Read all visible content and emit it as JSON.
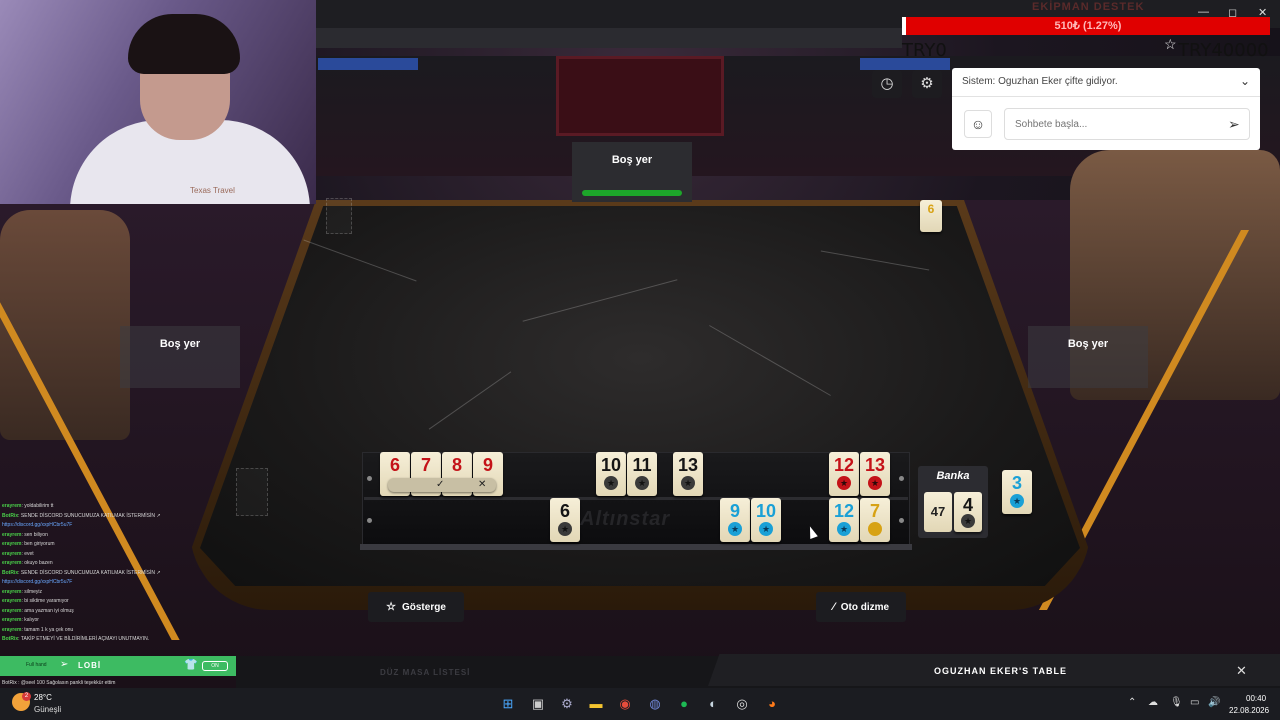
{
  "stream": {
    "donation_title": "EKİPMAN DESTEK",
    "donation_progress_text": "510₺ (1.27%)",
    "donation_progress": 0.0127,
    "goal_current": "TRY0",
    "goal_target": "TRY40000"
  },
  "game": {
    "seats": {
      "top": "Boş yer",
      "left": "Boş yer",
      "right": "Boş yer"
    },
    "discard_tile": {
      "value": "6",
      "color": "yellow"
    },
    "rack": {
      "brand": "Altınstar",
      "row1": [
        {
          "value": "6",
          "color": "red"
        },
        {
          "value": "7",
          "color": "red"
        },
        {
          "value": "8",
          "color": "red"
        },
        {
          "value": "9",
          "color": "red"
        },
        {
          "value": "10",
          "color": "black"
        },
        {
          "value": "11",
          "color": "black"
        },
        {
          "value": "13",
          "color": "black"
        },
        {
          "value": "12",
          "color": "red"
        },
        {
          "value": "13",
          "color": "red"
        }
      ],
      "row2": [
        {
          "value": "6",
          "color": "black"
        },
        {
          "value": "9",
          "color": "blue"
        },
        {
          "value": "10",
          "color": "blue"
        },
        {
          "value": "12",
          "color": "blue"
        },
        {
          "value": "7",
          "color": "yellow"
        }
      ]
    },
    "bank": {
      "title": "Banka",
      "count": "47",
      "indicator": {
        "value": "4",
        "color": "black"
      }
    },
    "extra_tile": {
      "value": "3",
      "color": "blue"
    },
    "buttons": {
      "gosterge": "Gösterge",
      "oto_dizme": "Oto dizme"
    },
    "colors": {
      "red": "#c41218",
      "black": "#151515",
      "blue": "#1aa0d6",
      "yellow": "#d7a215",
      "ready_bar": "#1da62a"
    }
  },
  "chat": {
    "system_message": "Sistem: Oguzhan Eker çifte gidiyor.",
    "input_placeholder": "Sohbete başla..."
  },
  "lobby": {
    "label": "LOBİ",
    "masa_list": "DÜZ MASA LİSTESİ",
    "table_title": "OGUZHAN EKER'S TABLE"
  },
  "twitch_chat": [
    {
      "user": "erayrem",
      "text": ": yoldabilirim tt"
    },
    {
      "user": "BotRix",
      "text": ": SENDE DİSCORD SUNUCUMUZA KATILMAK İSTERMİSİN ↗"
    },
    {
      "user": "",
      "text": "https://discord.gg/xxpHCbr5u7F",
      "link": true
    },
    {
      "user": "erayrem",
      "text": ": sen biliyon"
    },
    {
      "user": "erayrem",
      "text": ": ben giriyorum"
    },
    {
      "user": "erayrem",
      "text": ": evet"
    },
    {
      "user": "erayrem",
      "text": ": okuyo bazen"
    },
    {
      "user": "BotRix",
      "text": ": SENDE DİSCORD SUNUCUMUZA KATILMAK İSTERMİSİN ↗"
    },
    {
      "user": "",
      "text": "https://discord.gg/xxpHCbr5u7F",
      "link": true
    },
    {
      "user": "erayrem",
      "text": ": silmeyiz"
    },
    {
      "user": "erayrem",
      "text": ": bi siktime yaramıyor"
    },
    {
      "user": "erayrem",
      "text": ": ama yazman iyi olmuş"
    },
    {
      "user": "erayrem",
      "text": ": kalıyor"
    },
    {
      "user": "erayrem",
      "text": ": tamam 1 k ya çek onu"
    },
    {
      "user": "BotRix",
      "text": ": TAKİP ETMEYİ VE BİLDİRİMLERİ AÇMAYI UNUTMAYIN."
    }
  ],
  "twitch_last": "BotRix : @seel 100 Sağolasın pankli teşekkür ettim",
  "taskbar": {
    "weather_temp": "28°C",
    "weather_desc": "Güneşli",
    "weather_badge": "2",
    "time": "00:40",
    "date": "22.08.2026"
  },
  "webcam_shirt_text": "Texas Travel",
  "lobby_small": "Full hand",
  "lobby_toggle": "ON"
}
